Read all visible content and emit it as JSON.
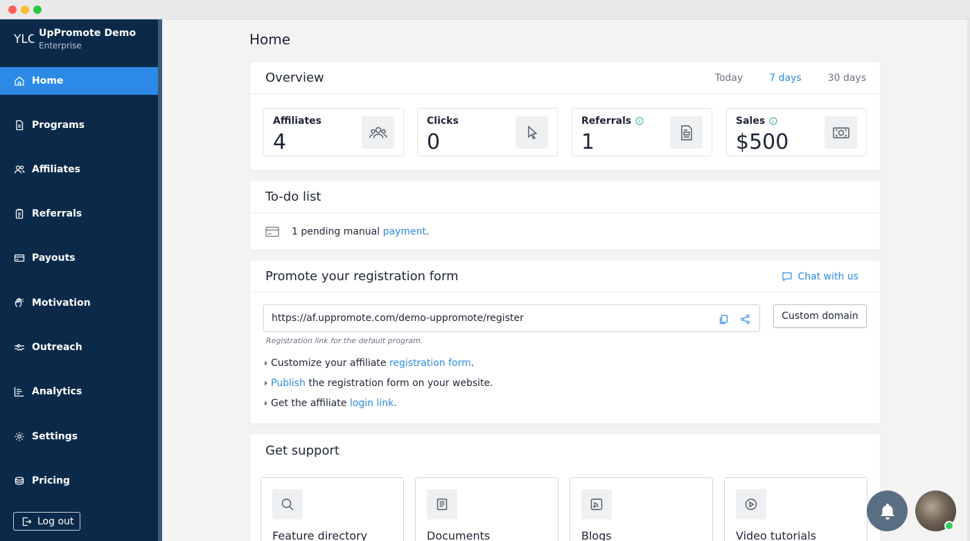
{
  "brand": {
    "logo_text": "YLC",
    "name": "UpPromote Demo",
    "plan": "Enterprise"
  },
  "sidebar": {
    "items": [
      {
        "label": "Home",
        "icon": "home-icon",
        "active": true
      },
      {
        "label": "Programs",
        "icon": "document-icon"
      },
      {
        "label": "Affiliates",
        "icon": "users-icon"
      },
      {
        "label": "Referrals",
        "icon": "clipboard-icon"
      },
      {
        "label": "Payouts",
        "icon": "credit-card-icon"
      },
      {
        "label": "Motivation",
        "icon": "gesture-icon"
      },
      {
        "label": "Outreach",
        "icon": "handshake-icon"
      },
      {
        "label": "Analytics",
        "icon": "chart-icon"
      },
      {
        "label": "Settings",
        "icon": "gear-icon"
      },
      {
        "label": "Pricing",
        "icon": "coins-icon"
      }
    ],
    "logout_label": "Log out"
  },
  "page": {
    "title": "Home"
  },
  "overview": {
    "title": "Overview",
    "ranges": [
      "Today",
      "7 days",
      "30 days"
    ],
    "selected_range": "7 days",
    "stats": [
      {
        "label": "Affiliates",
        "value": "4",
        "icon": "users-icon"
      },
      {
        "label": "Clicks",
        "value": "0",
        "icon": "cursor-icon"
      },
      {
        "label": "Referrals",
        "value": "1",
        "icon": "receipt-icon",
        "info": true
      },
      {
        "label": "Sales",
        "value": "$500",
        "icon": "money-icon",
        "info": true
      }
    ]
  },
  "todo": {
    "title": "To-do list",
    "item_prefix": "1 pending manual ",
    "item_link": "payment",
    "item_suffix": "."
  },
  "promote": {
    "title": "Promote your registration form",
    "chat_label": "Chat with us",
    "url": "https://af.uppromote.com/demo-uppromote/register",
    "custom_domain_label": "Custom domain",
    "hint": "Registration link for the default program.",
    "steps": [
      {
        "prefix": "Customize your affiliate ",
        "link": "registration form",
        "suffix": "."
      },
      {
        "prefix": "",
        "link": "Publish",
        "suffix": " the registration form on your website."
      },
      {
        "prefix": "Get the affiliate ",
        "link": "login link",
        "suffix": "."
      }
    ]
  },
  "support": {
    "title": "Get support",
    "tiles": [
      {
        "label": "Feature directory",
        "icon": "search-icon"
      },
      {
        "label": "Documents",
        "icon": "book-icon"
      },
      {
        "label": "Blogs",
        "icon": "rss-icon"
      },
      {
        "label": "Video tutorials",
        "icon": "play-icon"
      }
    ]
  },
  "colors": {
    "sidebar_bg": "#0b2a4a",
    "accent": "#2c8ae6",
    "online": "#2fce5a"
  }
}
